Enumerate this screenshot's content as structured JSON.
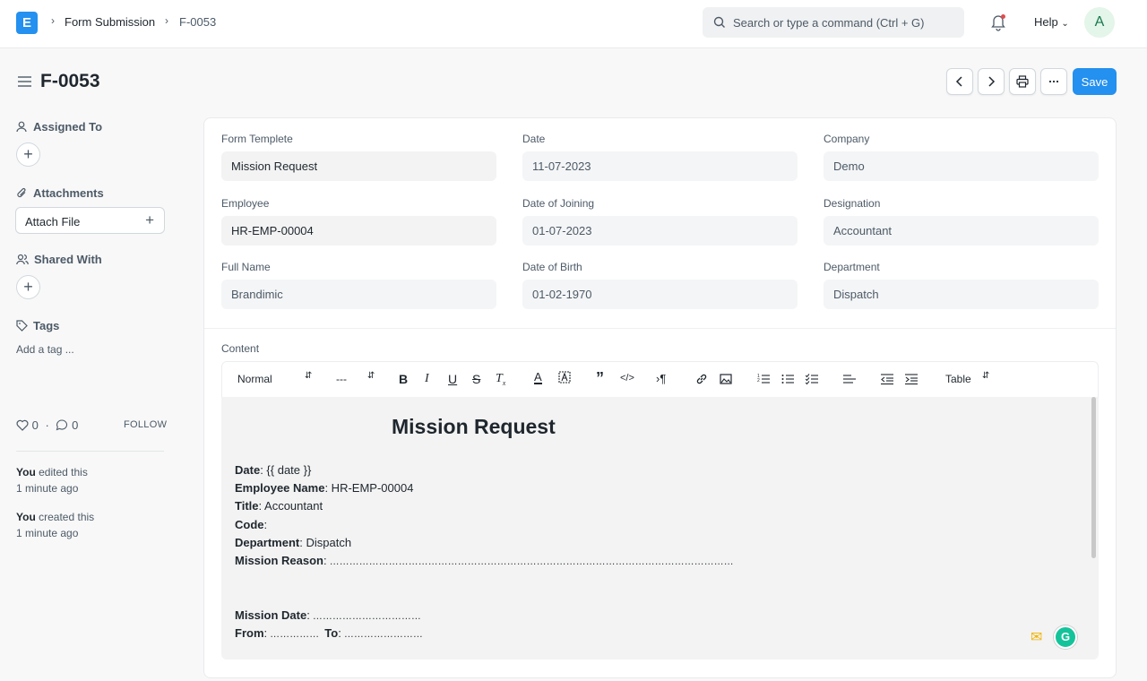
{
  "navbar": {
    "logo_letter": "E",
    "breadcrumbs": [
      "Form Submission",
      "F-0053"
    ],
    "search_placeholder": "Search or type a command (Ctrl + G)",
    "help_label": "Help",
    "avatar_initial": "A"
  },
  "page": {
    "title": "F-0053",
    "save_label": "Save"
  },
  "sidebar": {
    "assigned_to": "Assigned To",
    "attachments": "Attachments",
    "attach_file": "Attach File",
    "shared_with": "Shared With",
    "tags": "Tags",
    "add_tag": "Add a tag ...",
    "likes_count": "0",
    "comments_count": "0",
    "follow": "FOLLOW",
    "activity": [
      {
        "user": "You",
        "action": "edited this",
        "time": "1 minute ago"
      },
      {
        "user": "You",
        "action": "created this",
        "time": "1 minute ago"
      }
    ]
  },
  "form": {
    "fields": [
      {
        "label": "Form Templete",
        "value": "Mission Request"
      },
      {
        "label": "Date",
        "value": "11-07-2023"
      },
      {
        "label": "Company",
        "value": "Demo"
      },
      {
        "label": "Employee",
        "value": "HR-EMP-00004"
      },
      {
        "label": "Date of Joining",
        "value": "01-07-2023"
      },
      {
        "label": "Designation",
        "value": "Accountant"
      },
      {
        "label": "Full Name",
        "value": "Brandimic"
      },
      {
        "label": "Date of Birth",
        "value": "01-02-1970"
      },
      {
        "label": "Department",
        "value": "Dispatch"
      }
    ],
    "content_label": "Content"
  },
  "toolbar": {
    "style_select": "Normal",
    "size_select": "---",
    "table_select": "Table"
  },
  "editor": {
    "title": "Mission Request",
    "lines": [
      {
        "key": "Date",
        "value": "  {{ date }}"
      },
      {
        "key": "Employee Name",
        "value": " HR-EMP-00004"
      },
      {
        "key": "Title",
        "value": " Accountant"
      },
      {
        "key": "Code",
        "value": ""
      },
      {
        "key": "Department",
        "value": " Dispatch"
      },
      {
        "key": "Mission Reason",
        "value": " ……………………………………………………………………………………………………………"
      },
      {
        "key": "Mission Date",
        "value": " ……………………………"
      },
      {
        "key": "From",
        "value": " ……………  ",
        "key2": "To",
        "value2": " ……………………"
      }
    ],
    "grammarly_letter": "G"
  }
}
